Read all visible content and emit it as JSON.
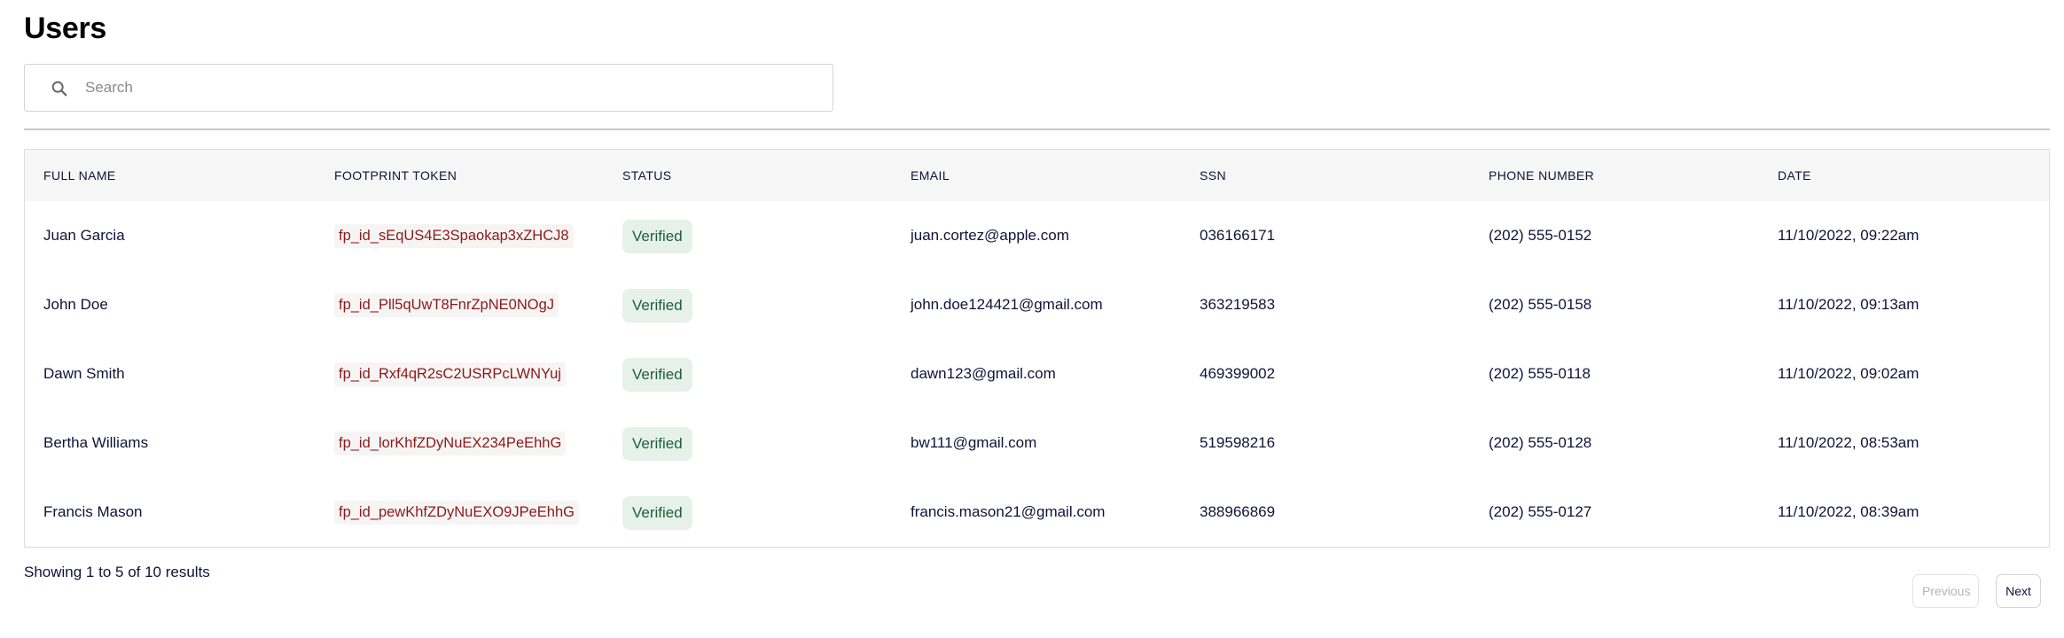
{
  "page": {
    "title": "Users"
  },
  "search": {
    "placeholder": "Search",
    "value": ""
  },
  "table": {
    "columns": [
      "FULL NAME",
      "FOOTPRINT TOKEN",
      "STATUS",
      "EMAIL",
      "SSN",
      "PHONE NUMBER",
      "DATE"
    ],
    "rows": [
      {
        "full_name": "Juan Garcia",
        "token": "fp_id_sEqUS4E3Spaokap3xZHCJ8",
        "status": "Verified",
        "email": "juan.cortez@apple.com",
        "ssn": "036166171",
        "phone": "(202) 555-0152",
        "date": "11/10/2022, 09:22am"
      },
      {
        "full_name": "John Doe",
        "token": "fp_id_Pll5qUwT8FnrZpNE0NOgJ",
        "status": "Verified",
        "email": "john.doe124421@gmail.com",
        "ssn": "363219583",
        "phone": "(202) 555-0158",
        "date": "11/10/2022, 09:13am"
      },
      {
        "full_name": "Dawn Smith",
        "token": "fp_id_Rxf4qR2sC2USRPcLWNYuj",
        "status": "Verified",
        "email": "dawn123@gmail.com",
        "ssn": "469399002",
        "phone": "(202) 555-0118",
        "date": "11/10/2022, 09:02am"
      },
      {
        "full_name": "Bertha Williams",
        "token": "fp_id_lorKhfZDyNuEX234PeEhhG",
        "status": "Verified",
        "email": "bw111@gmail.com",
        "ssn": "519598216",
        "phone": "(202) 555-0128",
        "date": "11/10/2022, 08:53am"
      },
      {
        "full_name": "Francis Mason",
        "token": "fp_id_pewKhfZDyNuEXO9JPeEhhG",
        "status": "Verified",
        "email": "francis.mason21@gmail.com",
        "ssn": "388966869",
        "phone": "(202) 555-0127",
        "date": "11/10/2022, 08:39am"
      }
    ]
  },
  "pagination": {
    "summary": "Showing 1 to 5 of 10 results",
    "previous_label": "Previous",
    "next_label": "Next",
    "previous_disabled": true
  },
  "icons": {
    "search": "search-icon"
  },
  "colors": {
    "token_text": "#8b1a1a",
    "badge_bg": "#e6f1ea",
    "badge_text": "#1f5e3a",
    "header_bg": "#f6f6f6"
  }
}
